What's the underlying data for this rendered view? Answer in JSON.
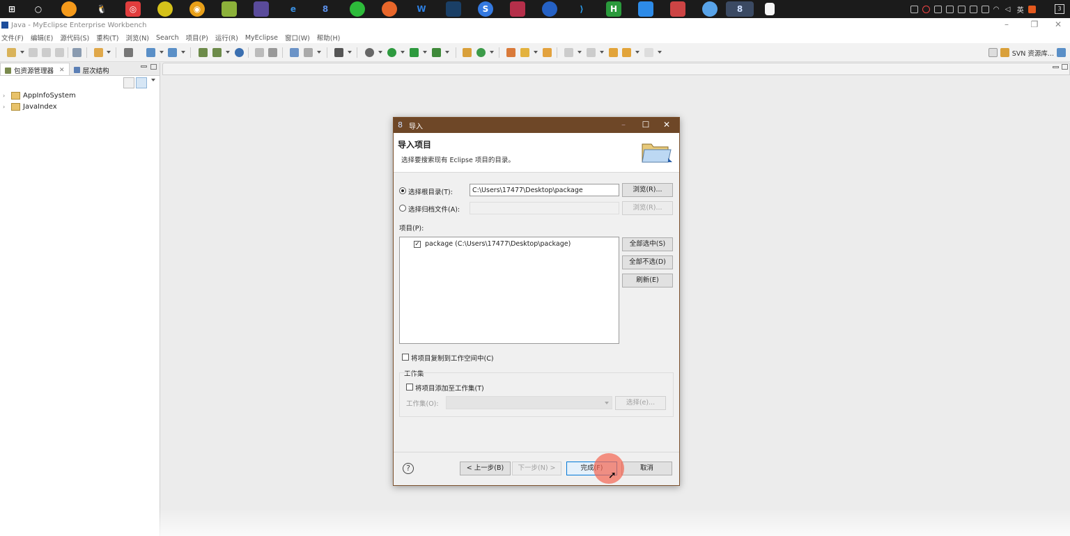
{
  "taskbar": {
    "apps": [
      "start-icon",
      "cortana-icon",
      "overwatch-icon",
      "qq-icon",
      "netease-music-icon",
      "app-icon",
      "chrome-icon",
      "notepad-icon",
      "dolphin-icon",
      "edge-icon",
      "myeclipse-icon",
      "wechat-icon",
      "firefox-icon",
      "ws-icon",
      "terminal-icon",
      "sogou-icon",
      "jetbrains-icon",
      "app-blue-icon",
      "vscode-icon",
      "hbuilder-icon",
      "cloud-app-icon",
      "photo-app-icon",
      "cloud-icon",
      "myeclipse-active-icon",
      "document-icon"
    ],
    "tray_lang": "英",
    "notification_count": "3"
  },
  "window": {
    "title": "Java - MyEclipse Enterprise Workbench"
  },
  "menu": [
    "文件(F)",
    "编辑(E)",
    "源代码(S)",
    "重构(T)",
    "浏览(N)",
    "Search",
    "项目(P)",
    "运行(R)",
    "MyEclipse",
    "窗口(W)",
    "帮助(H)"
  ],
  "perspective": {
    "label": "SVN 资源库..."
  },
  "left_view": {
    "tabs": [
      {
        "label": "包资源管理器",
        "active": true
      },
      {
        "label": "层次结构",
        "active": false
      }
    ],
    "tree": [
      {
        "label": "AppInfoSystem"
      },
      {
        "label": "JavaIndex"
      }
    ]
  },
  "dialog": {
    "title": "导入",
    "heading": "导入项目",
    "description": "选择要搜索现有 Eclipse 项目的目录。",
    "root_dir_label": "选择根目录(T):",
    "root_dir_value": "C:\\Users\\17477\\Desktop\\package",
    "browse1": "浏览(R)...",
    "archive_label": "选择归档文件(A):",
    "archive_value": "",
    "browse2": "浏览(R)...",
    "projects_label": "项目(P):",
    "projects": [
      {
        "label": "package (C:\\Users\\17477\\Desktop\\package)",
        "checked": true
      }
    ],
    "select_all": "全部选中(S)",
    "deselect_all": "全部不选(D)",
    "refresh": "刷新(E)",
    "copy_to_workspace": "将项目复制到工作空间中(C)",
    "workingset_group": "工作集",
    "add_to_workingset": "将项目添加至工作集(T)",
    "workingset_label": "工作集(O):",
    "workingset_value": "",
    "select_ws": "选择(e)...",
    "back": "< 上一步(B)",
    "next": "下一步(N) >",
    "finish": "完成(F)",
    "cancel": "取消"
  },
  "colors": {
    "dialog_titlebar": "#6e4727",
    "default_button_border": "#0078d7",
    "click_marker": "#f46450"
  }
}
